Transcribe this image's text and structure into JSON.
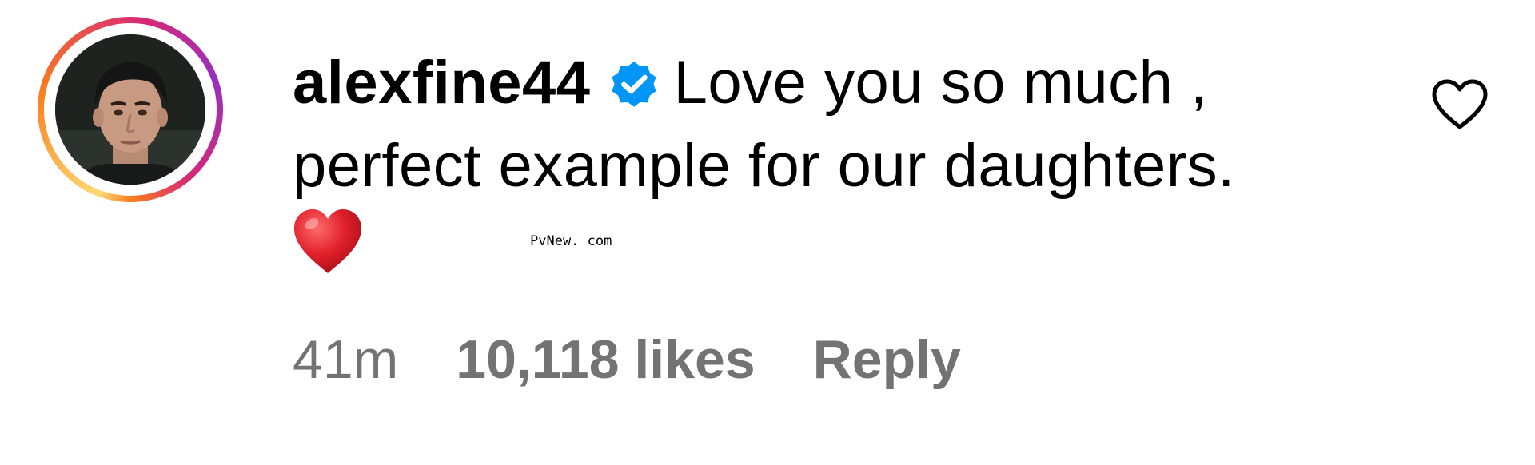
{
  "comment": {
    "username": "alexfine44",
    "verified": true,
    "text": "Love you so much , perfect example for our daughters.",
    "emoji": "red-heart",
    "watermark": "PvNew. com",
    "meta": {
      "time": "41m",
      "likes": "10,118 likes",
      "reply_label": "Reply"
    },
    "like_icon": "heart-outline-icon",
    "colors": {
      "verified_blue": "#0095f6",
      "meta_gray": "#737373",
      "emoji_red": "#e0202b"
    }
  }
}
